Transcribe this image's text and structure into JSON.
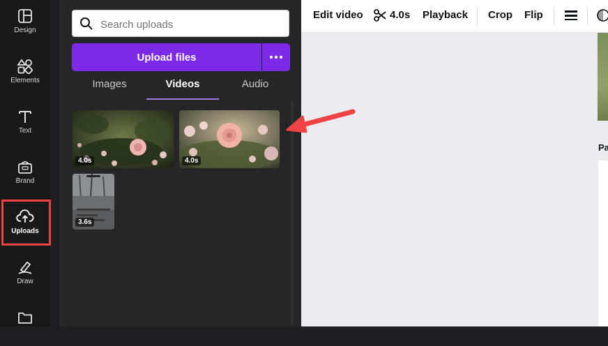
{
  "sidebar": {
    "items": [
      {
        "label": "Design",
        "icon": "design-icon"
      },
      {
        "label": "Elements",
        "icon": "elements-icon"
      },
      {
        "label": "Text",
        "icon": "text-icon"
      },
      {
        "label": "Brand",
        "icon": "brand-icon"
      },
      {
        "label": "Uploads",
        "icon": "upload-cloud-icon",
        "active": true
      },
      {
        "label": "Draw",
        "icon": "draw-icon"
      },
      {
        "label": "",
        "icon": "folder-icon"
      }
    ]
  },
  "uploads": {
    "search_placeholder": "Search uploads",
    "upload_button": "Upload files",
    "tabs": [
      "Images",
      "Videos",
      "Audio"
    ],
    "active_tab": "Videos",
    "videos": [
      {
        "duration": "4.0s"
      },
      {
        "duration": "4.0s"
      },
      {
        "duration": "3.6s"
      }
    ]
  },
  "toolbar": {
    "edit_video": "Edit video",
    "duration": "4.0s",
    "playback": "Playback",
    "crop": "Crop",
    "flip": "Flip"
  },
  "canvas": {
    "page_label": "Pa"
  },
  "colors": {
    "accent": "#7d2ae8",
    "highlight": "#ef4343"
  }
}
